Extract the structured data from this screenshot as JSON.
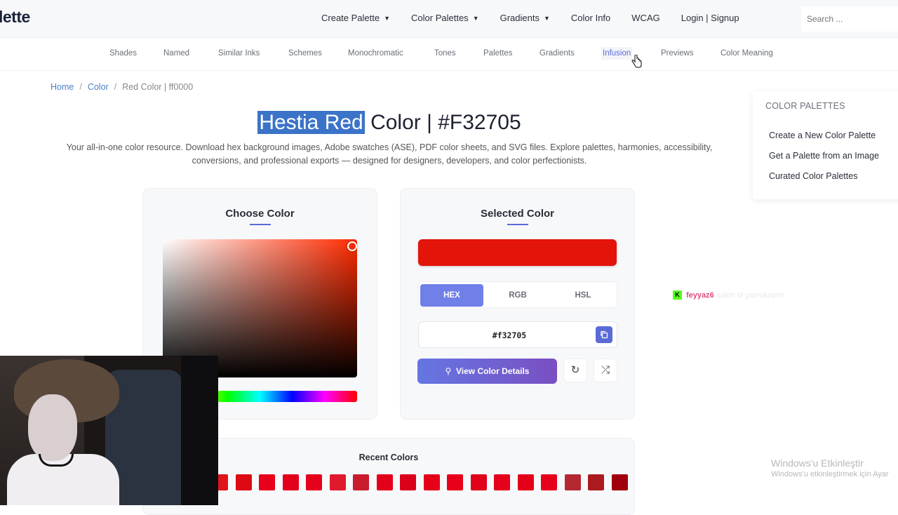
{
  "header": {
    "logo": "lette",
    "nav": [
      {
        "label": "Create Palette",
        "dropdown": true
      },
      {
        "label": "Color Palettes",
        "dropdown": true
      },
      {
        "label": "Gradients",
        "dropdown": true
      },
      {
        "label": "Color Info",
        "dropdown": false
      },
      {
        "label": "WCAG",
        "dropdown": false
      },
      {
        "label": "Login | Signup",
        "dropdown": false
      }
    ],
    "search_placeholder": "Search ..."
  },
  "subnav": {
    "links": [
      "Shades",
      "Named",
      "Similar Inks",
      "Schemes",
      "Monochromatic",
      "Tones",
      "Palettes",
      "Gradients",
      "Infusion",
      "Previews",
      "Color Meaning"
    ],
    "active": "Infusion"
  },
  "breadcrumb": {
    "home": "Home",
    "sep": "/",
    "color": "Color",
    "current": "Red Color | ff0000"
  },
  "page": {
    "title_highlight": "Hestia Red",
    "title_rest": " Color | #F32705",
    "description": "Your all-in-one color resource. Download hex background images, Adobe swatches (ASE), PDF color sheets, and SVG files. Explore palettes, harmonies, accessibility, conversions, and professional exports — designed for designers, developers, and color perfectionists."
  },
  "picker_card": {
    "title": "Choose Color"
  },
  "selected_card": {
    "title": "Selected Color",
    "color": "#e3140a",
    "tabs": [
      "HEX",
      "RGB",
      "HSL"
    ],
    "active_tab": "HEX",
    "hex_value": "#f32705",
    "view_button": "View Color Details"
  },
  "recent": {
    "title": "Recent Colors",
    "swatches": [
      "#e0141b",
      "#dd0a14",
      "#e8001a",
      "#e3001b",
      "#e5001c",
      "#e01a2c",
      "#c91d2e",
      "#e3001a",
      "#dc001b",
      "#e5001a",
      "#e8001b",
      "#e0001a",
      "#e5001c",
      "#e5001a",
      "#e6001c",
      "#b52832",
      "#ab1a1f",
      "#a0000e"
    ]
  },
  "sidebar": {
    "heading": "COLOR PALETTES",
    "links": [
      "Create a New Color Palette",
      "Get a Palette from an Image",
      "Curated Color Palettes"
    ]
  },
  "overlay": {
    "chat_user": "feyyaz6",
    "chat_message": "sakin ol yavrukayım",
    "windows_title": "Windows'u Etkinleştir",
    "windows_sub": "Windows'u etkinleştirmek için Ayar"
  },
  "colors": {
    "accent": "#5b6bd6",
    "selection": "#3b73c8"
  }
}
